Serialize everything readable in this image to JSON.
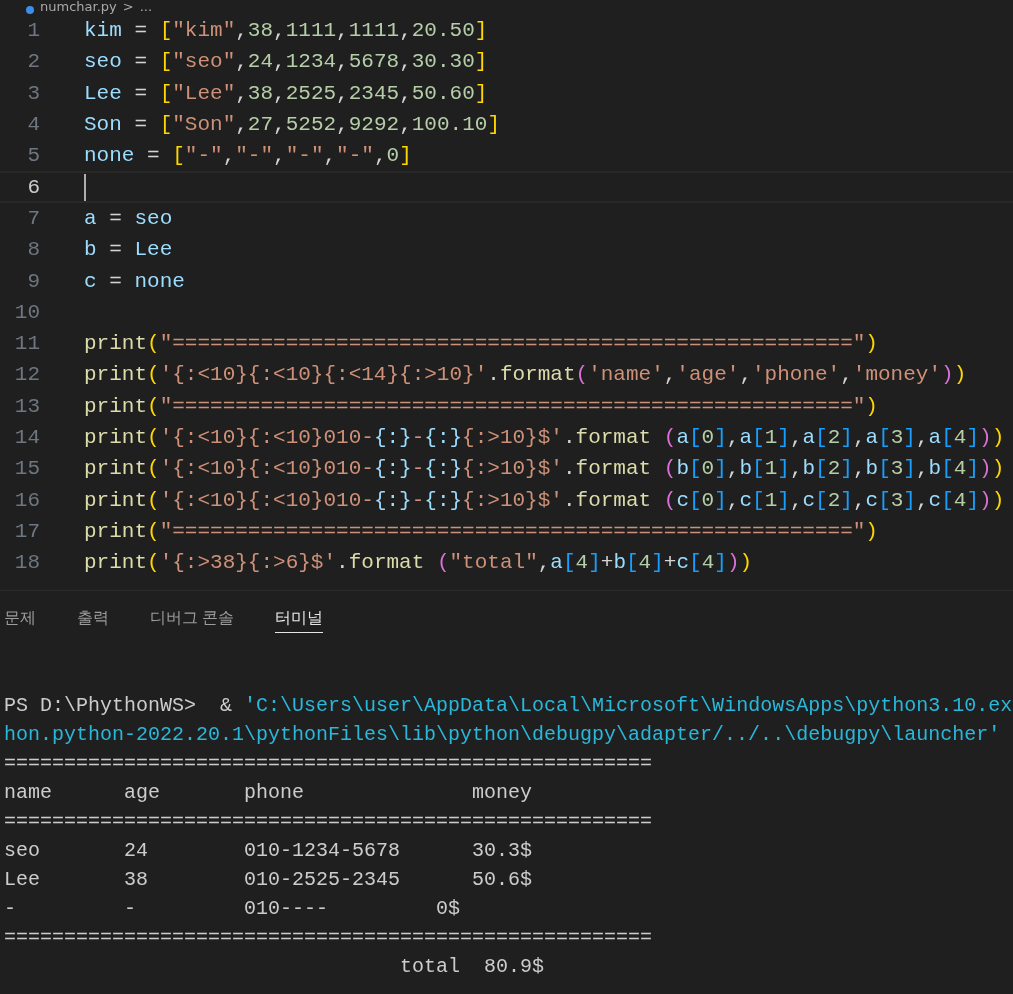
{
  "breadcrumb": {
    "file": "numchar.py",
    "separator": ">",
    "more": "..."
  },
  "editor": {
    "lines": [
      {
        "number": "1",
        "current": false,
        "tokens": [
          {
            "kind": "var",
            "text": "kim"
          },
          {
            "kind": "op",
            "text": " = "
          },
          {
            "kind": "bracket1",
            "text": "["
          },
          {
            "kind": "string",
            "text": "\"kim\""
          },
          {
            "kind": "op",
            "text": ","
          },
          {
            "kind": "number",
            "text": "38"
          },
          {
            "kind": "op",
            "text": ","
          },
          {
            "kind": "number",
            "text": "1111"
          },
          {
            "kind": "op",
            "text": ","
          },
          {
            "kind": "number",
            "text": "1111"
          },
          {
            "kind": "op",
            "text": ","
          },
          {
            "kind": "number",
            "text": "20.50"
          },
          {
            "kind": "bracket1",
            "text": "]"
          }
        ]
      },
      {
        "number": "2",
        "current": false,
        "tokens": [
          {
            "kind": "var",
            "text": "seo"
          },
          {
            "kind": "op",
            "text": " = "
          },
          {
            "kind": "bracket1",
            "text": "["
          },
          {
            "kind": "string",
            "text": "\"seo\""
          },
          {
            "kind": "op",
            "text": ","
          },
          {
            "kind": "number",
            "text": "24"
          },
          {
            "kind": "op",
            "text": ","
          },
          {
            "kind": "number",
            "text": "1234"
          },
          {
            "kind": "op",
            "text": ","
          },
          {
            "kind": "number",
            "text": "5678"
          },
          {
            "kind": "op",
            "text": ","
          },
          {
            "kind": "number",
            "text": "30.30"
          },
          {
            "kind": "bracket1",
            "text": "]"
          }
        ]
      },
      {
        "number": "3",
        "current": false,
        "tokens": [
          {
            "kind": "var",
            "text": "Lee"
          },
          {
            "kind": "op",
            "text": " = "
          },
          {
            "kind": "bracket1",
            "text": "["
          },
          {
            "kind": "string",
            "text": "\"Lee\""
          },
          {
            "kind": "op",
            "text": ","
          },
          {
            "kind": "number",
            "text": "38"
          },
          {
            "kind": "op",
            "text": ","
          },
          {
            "kind": "number",
            "text": "2525"
          },
          {
            "kind": "op",
            "text": ","
          },
          {
            "kind": "number",
            "text": "2345"
          },
          {
            "kind": "op",
            "text": ","
          },
          {
            "kind": "number",
            "text": "50.60"
          },
          {
            "kind": "bracket1",
            "text": "]"
          }
        ]
      },
      {
        "number": "4",
        "current": false,
        "tokens": [
          {
            "kind": "var",
            "text": "Son"
          },
          {
            "kind": "op",
            "text": " = "
          },
          {
            "kind": "bracket1",
            "text": "["
          },
          {
            "kind": "string",
            "text": "\"Son\""
          },
          {
            "kind": "op",
            "text": ","
          },
          {
            "kind": "number",
            "text": "27"
          },
          {
            "kind": "op",
            "text": ","
          },
          {
            "kind": "number",
            "text": "5252"
          },
          {
            "kind": "op",
            "text": ","
          },
          {
            "kind": "number",
            "text": "9292"
          },
          {
            "kind": "op",
            "text": ","
          },
          {
            "kind": "number",
            "text": "100.10"
          },
          {
            "kind": "bracket1",
            "text": "]"
          }
        ]
      },
      {
        "number": "5",
        "current": false,
        "tokens": [
          {
            "kind": "var",
            "text": "none"
          },
          {
            "kind": "op",
            "text": " = "
          },
          {
            "kind": "bracket1",
            "text": "["
          },
          {
            "kind": "string",
            "text": "\"-\""
          },
          {
            "kind": "op",
            "text": ","
          },
          {
            "kind": "string",
            "text": "\"-\""
          },
          {
            "kind": "op",
            "text": ","
          },
          {
            "kind": "string",
            "text": "\"-\""
          },
          {
            "kind": "op",
            "text": ","
          },
          {
            "kind": "string",
            "text": "\"-\""
          },
          {
            "kind": "op",
            "text": ","
          },
          {
            "kind": "number",
            "text": "0"
          },
          {
            "kind": "bracket1",
            "text": "]"
          }
        ]
      },
      {
        "number": "6",
        "current": true
      },
      {
        "number": "7",
        "current": false,
        "tokens": [
          {
            "kind": "var",
            "text": "a"
          },
          {
            "kind": "op",
            "text": " = "
          },
          {
            "kind": "var",
            "text": "seo"
          }
        ]
      },
      {
        "number": "8",
        "current": false,
        "tokens": [
          {
            "kind": "var",
            "text": "b"
          },
          {
            "kind": "op",
            "text": " = "
          },
          {
            "kind": "var",
            "text": "Lee"
          }
        ]
      },
      {
        "number": "9",
        "current": false,
        "tokens": [
          {
            "kind": "var",
            "text": "c"
          },
          {
            "kind": "op",
            "text": " = "
          },
          {
            "kind": "var",
            "text": "none"
          }
        ]
      },
      {
        "number": "10",
        "current": false
      },
      {
        "number": "11",
        "current": false,
        "tokens": [
          {
            "kind": "func",
            "text": "print"
          },
          {
            "kind": "bracket1",
            "text": "("
          },
          {
            "kind": "string",
            "text": "\"======================================================\""
          },
          {
            "kind": "bracket1",
            "text": ")"
          }
        ]
      },
      {
        "number": "12",
        "current": false,
        "tokens": [
          {
            "kind": "func",
            "text": "print"
          },
          {
            "kind": "bracket1",
            "text": "("
          },
          {
            "kind": "string",
            "text": "'{:<10}{:<10}{:<14}{:>10}'"
          },
          {
            "kind": "op",
            "text": "."
          },
          {
            "kind": "func",
            "text": "format"
          },
          {
            "kind": "bracket2",
            "text": "("
          },
          {
            "kind": "string",
            "text": "'name'"
          },
          {
            "kind": "op",
            "text": ","
          },
          {
            "kind": "string",
            "text": "'age'"
          },
          {
            "kind": "op",
            "text": ","
          },
          {
            "kind": "string",
            "text": "'phone'"
          },
          {
            "kind": "op",
            "text": ","
          },
          {
            "kind": "string",
            "text": "'money'"
          },
          {
            "kind": "bracket2",
            "text": ")"
          },
          {
            "kind": "bracket1",
            "text": ")"
          }
        ]
      },
      {
        "number": "13",
        "current": false,
        "tokens": [
          {
            "kind": "func",
            "text": "print"
          },
          {
            "kind": "bracket1",
            "text": "("
          },
          {
            "kind": "string",
            "text": "\"======================================================\""
          },
          {
            "kind": "bracket1",
            "text": ")"
          }
        ]
      },
      {
        "number": "14",
        "current": false,
        "tokens": [
          {
            "kind": "func",
            "text": "print"
          },
          {
            "kind": "bracket1",
            "text": "("
          },
          {
            "kind": "string",
            "text": "'{:<10}{:<10}010-"
          },
          {
            "kind": "placeholder",
            "text": "{:}"
          },
          {
            "kind": "string",
            "text": "-"
          },
          {
            "kind": "placeholder",
            "text": "{:}"
          },
          {
            "kind": "string",
            "text": "{:>10}$'"
          },
          {
            "kind": "op",
            "text": "."
          },
          {
            "kind": "func",
            "text": "format"
          },
          {
            "kind": "bracket2",
            "text": " ("
          },
          {
            "kind": "var",
            "text": "a"
          },
          {
            "kind": "bracket3",
            "text": "["
          },
          {
            "kind": "number",
            "text": "0"
          },
          {
            "kind": "bracket3",
            "text": "]"
          },
          {
            "kind": "op",
            "text": ","
          },
          {
            "kind": "var",
            "text": "a"
          },
          {
            "kind": "bracket3",
            "text": "["
          },
          {
            "kind": "number",
            "text": "1"
          },
          {
            "kind": "bracket3",
            "text": "]"
          },
          {
            "kind": "op",
            "text": ","
          },
          {
            "kind": "var",
            "text": "a"
          },
          {
            "kind": "bracket3",
            "text": "["
          },
          {
            "kind": "number",
            "text": "2"
          },
          {
            "kind": "bracket3",
            "text": "]"
          },
          {
            "kind": "op",
            "text": ","
          },
          {
            "kind": "var",
            "text": "a"
          },
          {
            "kind": "bracket3",
            "text": "["
          },
          {
            "kind": "number",
            "text": "3"
          },
          {
            "kind": "bracket3",
            "text": "]"
          },
          {
            "kind": "op",
            "text": ","
          },
          {
            "kind": "var",
            "text": "a"
          },
          {
            "kind": "bracket3",
            "text": "["
          },
          {
            "kind": "number",
            "text": "4"
          },
          {
            "kind": "bracket3",
            "text": "]"
          },
          {
            "kind": "bracket2",
            "text": ")"
          },
          {
            "kind": "bracket1",
            "text": ")"
          }
        ]
      },
      {
        "number": "15",
        "current": false,
        "tokens": [
          {
            "kind": "func",
            "text": "print"
          },
          {
            "kind": "bracket1",
            "text": "("
          },
          {
            "kind": "string",
            "text": "'{:<10}{:<10}010-"
          },
          {
            "kind": "placeholder",
            "text": "{:}"
          },
          {
            "kind": "string",
            "text": "-"
          },
          {
            "kind": "placeholder",
            "text": "{:}"
          },
          {
            "kind": "string",
            "text": "{:>10}$'"
          },
          {
            "kind": "op",
            "text": "."
          },
          {
            "kind": "func",
            "text": "format"
          },
          {
            "kind": "bracket2",
            "text": " ("
          },
          {
            "kind": "var",
            "text": "b"
          },
          {
            "kind": "bracket3",
            "text": "["
          },
          {
            "kind": "number",
            "text": "0"
          },
          {
            "kind": "bracket3",
            "text": "]"
          },
          {
            "kind": "op",
            "text": ","
          },
          {
            "kind": "var",
            "text": "b"
          },
          {
            "kind": "bracket3",
            "text": "["
          },
          {
            "kind": "number",
            "text": "1"
          },
          {
            "kind": "bracket3",
            "text": "]"
          },
          {
            "kind": "op",
            "text": ","
          },
          {
            "kind": "var",
            "text": "b"
          },
          {
            "kind": "bracket3",
            "text": "["
          },
          {
            "kind": "number",
            "text": "2"
          },
          {
            "kind": "bracket3",
            "text": "]"
          },
          {
            "kind": "op",
            "text": ","
          },
          {
            "kind": "var",
            "text": "b"
          },
          {
            "kind": "bracket3",
            "text": "["
          },
          {
            "kind": "number",
            "text": "3"
          },
          {
            "kind": "bracket3",
            "text": "]"
          },
          {
            "kind": "op",
            "text": ","
          },
          {
            "kind": "var",
            "text": "b"
          },
          {
            "kind": "bracket3",
            "text": "["
          },
          {
            "kind": "number",
            "text": "4"
          },
          {
            "kind": "bracket3",
            "text": "]"
          },
          {
            "kind": "bracket2",
            "text": ")"
          },
          {
            "kind": "bracket1",
            "text": ")"
          }
        ]
      },
      {
        "number": "16",
        "current": false,
        "tokens": [
          {
            "kind": "func",
            "text": "print"
          },
          {
            "kind": "bracket1",
            "text": "("
          },
          {
            "kind": "string",
            "text": "'{:<10}{:<10}010-"
          },
          {
            "kind": "placeholder",
            "text": "{:}"
          },
          {
            "kind": "string",
            "text": "-"
          },
          {
            "kind": "placeholder",
            "text": "{:}"
          },
          {
            "kind": "string",
            "text": "{:>10}$'"
          },
          {
            "kind": "op",
            "text": "."
          },
          {
            "kind": "func",
            "text": "format"
          },
          {
            "kind": "bracket2",
            "text": " ("
          },
          {
            "kind": "var",
            "text": "c"
          },
          {
            "kind": "bracket3",
            "text": "["
          },
          {
            "kind": "number",
            "text": "0"
          },
          {
            "kind": "bracket3",
            "text": "]"
          },
          {
            "kind": "op",
            "text": ","
          },
          {
            "kind": "var",
            "text": "c"
          },
          {
            "kind": "bracket3",
            "text": "["
          },
          {
            "kind": "number",
            "text": "1"
          },
          {
            "kind": "bracket3",
            "text": "]"
          },
          {
            "kind": "op",
            "text": ","
          },
          {
            "kind": "var",
            "text": "c"
          },
          {
            "kind": "bracket3",
            "text": "["
          },
          {
            "kind": "number",
            "text": "2"
          },
          {
            "kind": "bracket3",
            "text": "]"
          },
          {
            "kind": "op",
            "text": ","
          },
          {
            "kind": "var",
            "text": "c"
          },
          {
            "kind": "bracket3",
            "text": "["
          },
          {
            "kind": "number",
            "text": "3"
          },
          {
            "kind": "bracket3",
            "text": "]"
          },
          {
            "kind": "op",
            "text": ","
          },
          {
            "kind": "var",
            "text": "c"
          },
          {
            "kind": "bracket3",
            "text": "["
          },
          {
            "kind": "number",
            "text": "4"
          },
          {
            "kind": "bracket3",
            "text": "]"
          },
          {
            "kind": "bracket2",
            "text": ")"
          },
          {
            "kind": "bracket1",
            "text": ")"
          }
        ]
      },
      {
        "number": "17",
        "current": false,
        "tokens": [
          {
            "kind": "func",
            "text": "print"
          },
          {
            "kind": "bracket1",
            "text": "("
          },
          {
            "kind": "string",
            "text": "\"======================================================\""
          },
          {
            "kind": "bracket1",
            "text": ")"
          }
        ]
      },
      {
        "number": "18",
        "current": false,
        "tokens": [
          {
            "kind": "func",
            "text": "print"
          },
          {
            "kind": "bracket1",
            "text": "("
          },
          {
            "kind": "string",
            "text": "'{:>38}{:>6}$'"
          },
          {
            "kind": "op",
            "text": "."
          },
          {
            "kind": "func",
            "text": "format"
          },
          {
            "kind": "bracket2",
            "text": " ("
          },
          {
            "kind": "string",
            "text": "\"total\""
          },
          {
            "kind": "op",
            "text": ","
          },
          {
            "kind": "var",
            "text": "a"
          },
          {
            "kind": "bracket3",
            "text": "["
          },
          {
            "kind": "number",
            "text": "4"
          },
          {
            "kind": "bracket3",
            "text": "]"
          },
          {
            "kind": "op",
            "text": "+"
          },
          {
            "kind": "var",
            "text": "b"
          },
          {
            "kind": "bracket3",
            "text": "["
          },
          {
            "kind": "number",
            "text": "4"
          },
          {
            "kind": "bracket3",
            "text": "]"
          },
          {
            "kind": "op",
            "text": "+"
          },
          {
            "kind": "var",
            "text": "c"
          },
          {
            "kind": "bracket3",
            "text": "["
          },
          {
            "kind": "number",
            "text": "4"
          },
          {
            "kind": "bracket3",
            "text": "]"
          },
          {
            "kind": "bracket2",
            "text": ")"
          },
          {
            "kind": "bracket1",
            "text": ")"
          }
        ]
      }
    ]
  },
  "panel": {
    "tabs": [
      {
        "label": "문제",
        "selected": false
      },
      {
        "label": "출력",
        "selected": false
      },
      {
        "label": "디버그 콘솔",
        "selected": false
      },
      {
        "label": "터미널",
        "selected": true
      }
    ]
  },
  "terminal": {
    "lines": [
      [
        {
          "kind": "plain",
          "text": "PS D:\\PhythonWS>  & "
        },
        {
          "kind": "path",
          "text": "'C:\\Users\\user\\AppData\\Local\\Microsoft\\WindowsApps\\python3.10.ex"
        }
      ],
      [
        {
          "kind": "path",
          "text": "hon.python-2022.20.1\\pythonFiles\\lib\\python\\debugpy\\adapter/../..\\debugpy\\launcher'"
        }
      ],
      [
        {
          "kind": "plain",
          "text": "======================================================"
        }
      ],
      [
        {
          "kind": "plain",
          "text": "name      age       phone              money"
        }
      ],
      [
        {
          "kind": "plain",
          "text": "======================================================"
        }
      ],
      [
        {
          "kind": "plain",
          "text": "seo       24        010-1234-5678      30.3$"
        }
      ],
      [
        {
          "kind": "plain",
          "text": "Lee       38        010-2525-2345      50.6$"
        }
      ],
      [
        {
          "kind": "plain",
          "text": "-         -         010----         0$"
        }
      ],
      [
        {
          "kind": "plain",
          "text": "======================================================"
        }
      ],
      [
        {
          "kind": "plain",
          "text": "                                 total  80.9$"
        }
      ]
    ]
  }
}
